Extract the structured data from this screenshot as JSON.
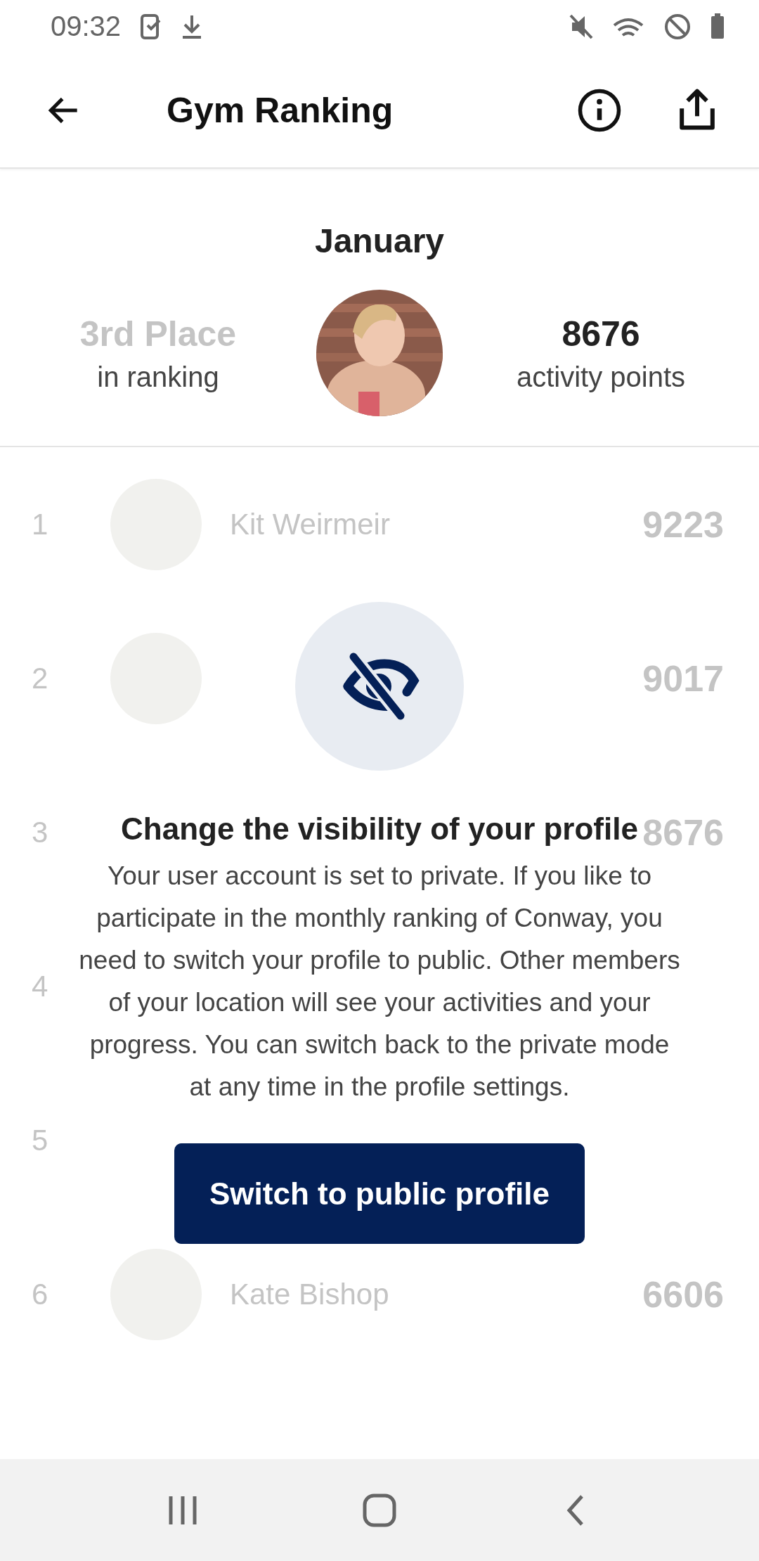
{
  "status_bar": {
    "time": "09:32"
  },
  "header": {
    "title": "Gym Ranking"
  },
  "summary": {
    "month": "January",
    "place": "3rd Place",
    "place_caption": "in ranking",
    "points": "8676",
    "points_caption": "activity points"
  },
  "ranking": [
    {
      "rank": "1",
      "name": "Kit Weirmeir",
      "points": "9223"
    },
    {
      "rank": "2",
      "points": "9017"
    },
    {
      "rank": "3",
      "points": "8676"
    },
    {
      "rank": "4"
    },
    {
      "rank": "5"
    },
    {
      "rank": "6",
      "name": "Kate Bishop",
      "points": "6606"
    }
  ],
  "privacy_notice": {
    "title": "Change the visibility of your profile",
    "body": "Your user account is set to private. If you like to participate in the monthly ranking of Conway, you need to switch your profile to public. Other members of your location will see your activities and your progress. You can switch back to the private mode at any time in the profile settings.",
    "button": "Switch to public profile"
  }
}
